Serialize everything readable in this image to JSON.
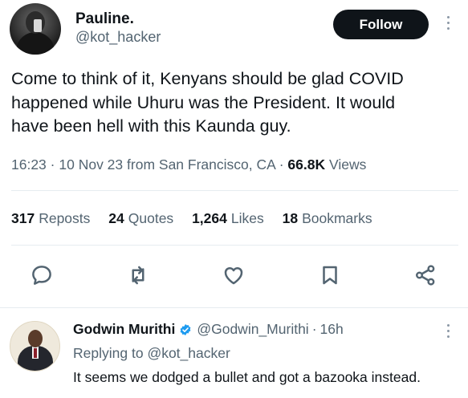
{
  "tweet": {
    "display_name": "Pauline.",
    "handle": "@kot_hacker",
    "follow_label": "Follow",
    "text": "Come to think of it, Kenyans should be glad COVID\nhappened while Uhuru was the President. It would\nhave been hell with this Kaunda guy.",
    "time": "16:23",
    "date": "10 Nov 23",
    "source": "from San Francisco, CA",
    "views_count": "66.8K",
    "views_label": "Views",
    "stats": [
      {
        "count": "317",
        "label": "Reposts"
      },
      {
        "count": "24",
        "label": "Quotes"
      },
      {
        "count": "1,264",
        "label": "Likes"
      },
      {
        "count": "18",
        "label": "Bookmarks"
      }
    ],
    "actions": [
      "reply-icon",
      "repost-icon",
      "like-icon",
      "bookmark-icon",
      "share-icon"
    ]
  },
  "reply": {
    "display_name": "Godwin Murithi",
    "verified": true,
    "handle": "@Godwin_Murithi",
    "time": "16h",
    "replying_prefix": "Replying to",
    "replying_to": "@kot_hacker",
    "text": "It seems we dodged a bullet and got a bazooka instead."
  },
  "colors": {
    "primary_text": "#0f1419",
    "secondary_text": "#536471",
    "follow_bg": "#0f1419",
    "verified_blue": "#1d9bf0",
    "divider": "#e6ecf0"
  }
}
